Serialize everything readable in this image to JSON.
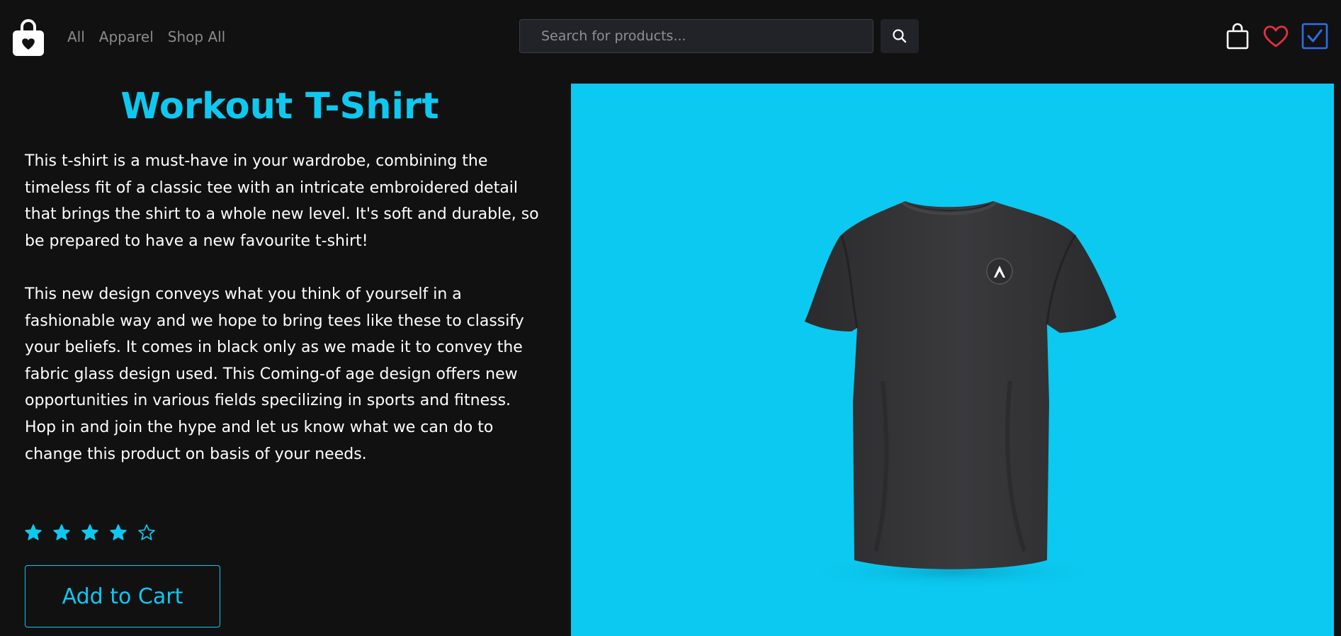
{
  "header": {
    "logo_icon": "shopping-bag-heart-icon",
    "nav": [
      "All",
      "Apparel",
      "Shop All"
    ],
    "search": {
      "placeholder": "Search for products...",
      "value": ""
    },
    "search_icon": "search-icon",
    "icons": [
      "shopping-bag-icon",
      "heart-icon",
      "checkbox-icon"
    ]
  },
  "product": {
    "title": "Workout T-Shirt",
    "description": [
      "This t-shirt is a must-have in your wardrobe, combining the timeless fit of a classic tee with an intricate embroidered detail that brings the shirt to a whole new level. It's soft and durable, so be prepared to have a new favourite t-shirt!",
      "This new design conveys what you think of yourself in a fashionable way and we hope to bring tees like these to classify your beliefs. It comes in black only as we made it to convey the fabric glass design used. This Coming-of age design offers new opportunities in various fields specilizing in sports and fitness. Hop in and join the hype and let us know what we can do to change this product on basis of your needs."
    ],
    "rating": {
      "value": 4,
      "max": 5
    },
    "add_to_cart_label": "Add to Cart"
  },
  "colors": {
    "background": "#111112",
    "accent": "#0fc8f0",
    "image_background": "#0bc9f0",
    "heart": "#e5303e",
    "checkbox": "#2f6ee8",
    "nav_text": "#8b8b8e"
  }
}
